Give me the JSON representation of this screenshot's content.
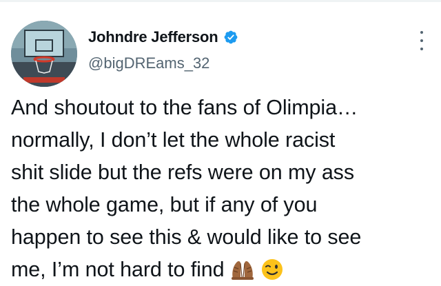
{
  "tweet": {
    "author": {
      "display_name": "Johndre Jefferson",
      "handle": "@bigDREams_32",
      "verified": true,
      "avatar_icon": "basketball-hoop-photo"
    },
    "text": "And shoutout to the fans of Olimpia…\nnormally, I don’t let the whole racist\nshit slide but the refs were on my ass\nthe whole game, but if any of you\nhappen to see this & would like to see\nme, I’m not hard to find",
    "emojis": [
      "praying-hands-emoji",
      "winking-face-emoji"
    ],
    "colors": {
      "text": "#0f1419",
      "secondary": "#536471",
      "verified": "#1d9bf0"
    }
  }
}
